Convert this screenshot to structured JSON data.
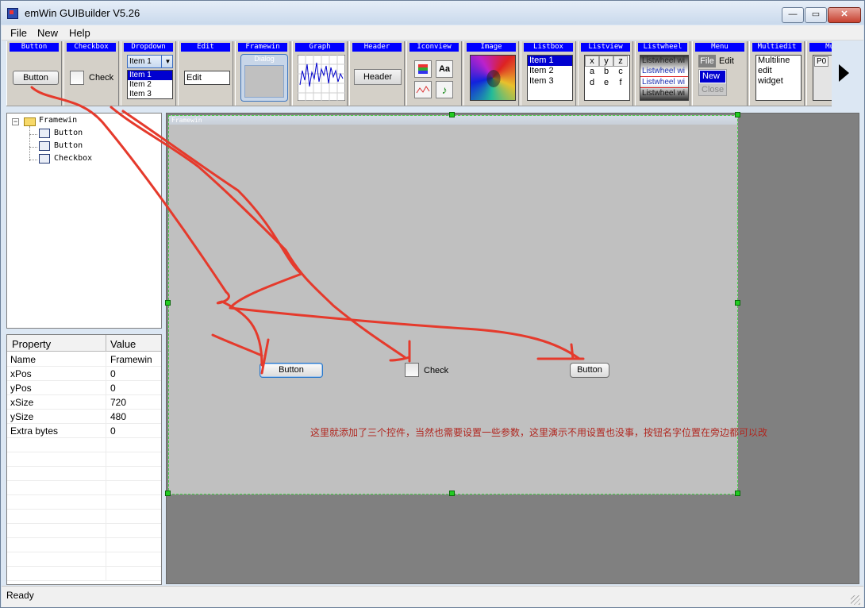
{
  "window": {
    "title": "emWin GUIBuilder V5.26",
    "controls": {
      "minimize": "—",
      "maximize": "▭",
      "close": "✕"
    }
  },
  "menu": {
    "items": [
      "File",
      "New",
      "Help"
    ]
  },
  "toolbar": {
    "tools": [
      {
        "name": "Button",
        "sample": "Button"
      },
      {
        "name": "Checkbox",
        "sample": "Check"
      },
      {
        "name": "Dropdown",
        "items": [
          "Item 1",
          "Item 1",
          "Item 2",
          "Item 3"
        ]
      },
      {
        "name": "Edit",
        "sample": "Edit"
      },
      {
        "name": "Framewin",
        "sample": "Dialog"
      },
      {
        "name": "Graph"
      },
      {
        "name": "Header",
        "sample": "Header"
      },
      {
        "name": "Iconview",
        "glyph": "Aa"
      },
      {
        "name": "Image"
      },
      {
        "name": "Listbox",
        "items": [
          "Item 1",
          "Item 2",
          "Item 3"
        ]
      },
      {
        "name": "Listview",
        "cells": [
          "x",
          "y",
          "z",
          "a",
          "b",
          "c",
          "d",
          "e",
          "f"
        ]
      },
      {
        "name": "Listwheel",
        "items": [
          "Listwheel wi",
          "Listwheel wi",
          "Listwheel wi",
          "Listwheel wi"
        ]
      },
      {
        "name": "Menu",
        "items": [
          "File",
          "Edit",
          "New",
          "Close"
        ]
      },
      {
        "name": "Multiedit",
        "lines": [
          "Multiline",
          "edit",
          "widget"
        ]
      },
      {
        "name": "Mult",
        "sample": "P0"
      }
    ],
    "scroll_arrow": "right-arrow-icon"
  },
  "tree": {
    "root": "Framewin",
    "children": [
      "Button",
      "Button",
      "Checkbox"
    ]
  },
  "properties": {
    "headers": {
      "property": "Property",
      "value": "Value"
    },
    "rows": [
      {
        "name": "Name",
        "value": "Framewin"
      },
      {
        "name": "xPos",
        "value": "0"
      },
      {
        "name": "yPos",
        "value": "0"
      },
      {
        "name": "xSize",
        "value": "720"
      },
      {
        "name": "ySize",
        "value": "480"
      },
      {
        "name": "Extra bytes",
        "value": "0"
      }
    ]
  },
  "design": {
    "framewin_title": "Framewin",
    "widgets": {
      "button1": "Button",
      "checkbox": "Check",
      "button2": "Button"
    },
    "annotation_text": "这里就添加了三个控件，当然也需要设置一些参数，这里演示不用设置也没事，按钮名字位置在旁边都可以改"
  },
  "status": {
    "text": "Ready"
  },
  "colors": {
    "accent": "#0000ff",
    "annotation": "#e53a2c",
    "note_text": "#b0261f",
    "selection_handle": "#22cc22"
  }
}
